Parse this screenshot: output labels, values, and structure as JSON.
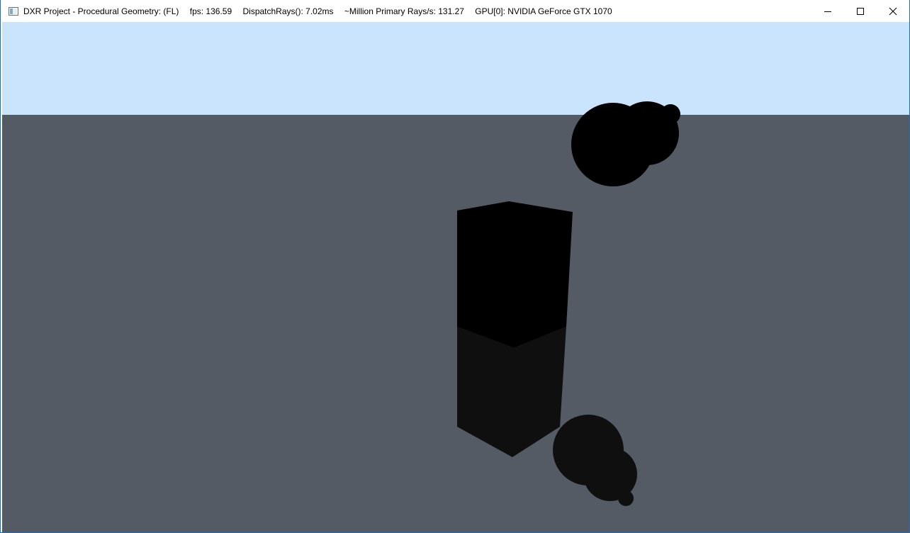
{
  "window": {
    "title": "DXR Project - Procedural Geometry: (FL)",
    "fps": "fps: 136.59",
    "dispatch_rays": "DispatchRays(): 7.02ms",
    "primary_rays": "~Million Primary Rays/s: 131.27",
    "gpu": "GPU[0]: NVIDIA GeForce GTX 1070"
  },
  "controls": {
    "minimize_icon": "minimize-icon",
    "maximize_icon": "maximize-icon",
    "close_icon": "close-icon"
  },
  "scene": {
    "sky_color": "#cbe4fd",
    "ground_color": "#545b64",
    "object_color": "#000000",
    "reflection_color": "#0f0f0f"
  }
}
